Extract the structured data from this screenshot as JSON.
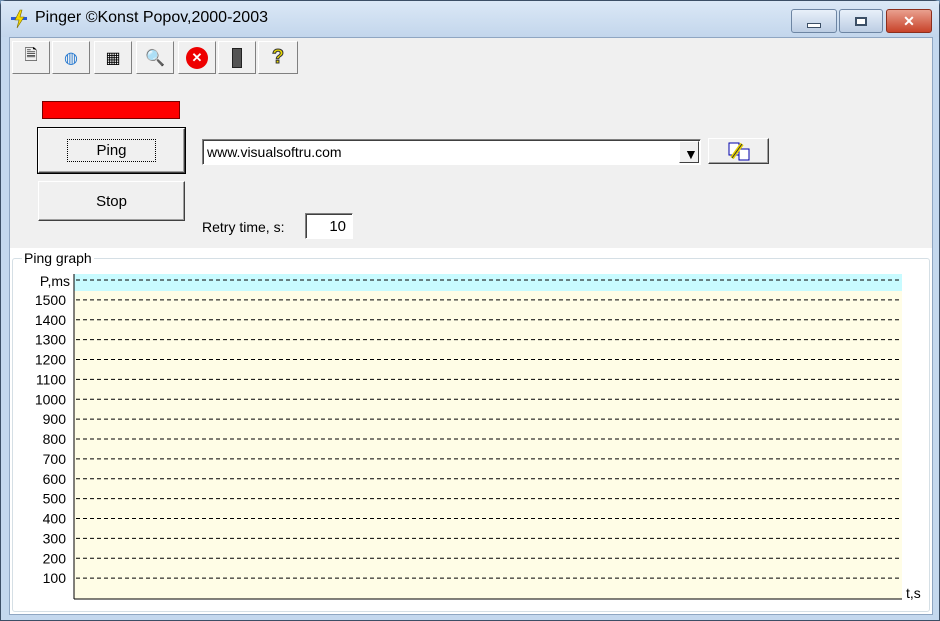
{
  "window": {
    "title": "Pinger ©Konst Popov,2000-2003",
    "controls": [
      "minimize",
      "maximize",
      "close"
    ]
  },
  "toolbar": [
    {
      "icon": "properties-icon",
      "glyph": "🗎"
    },
    {
      "icon": "network-search-icon",
      "glyph": "🌐"
    },
    {
      "icon": "log-table-icon",
      "glyph": "▦"
    },
    {
      "icon": "find-icon",
      "glyph": "🔍"
    },
    {
      "icon": "stop-red-icon",
      "glyph": "✕"
    },
    {
      "icon": "server-icon",
      "glyph": "▮"
    },
    {
      "icon": "help-icon",
      "glyph": "?"
    }
  ],
  "status_indicator": {
    "color": "#ff0000"
  },
  "buttons": {
    "ping": "Ping",
    "stop": "Stop"
  },
  "host": {
    "value": "www.visualsoftru.com"
  },
  "retry": {
    "label": "Retry time, s:",
    "value": "10"
  },
  "graph": {
    "group_label": "Ping graph"
  },
  "chart_data": {
    "type": "line",
    "ylabel": "P,ms",
    "xlabel": "t,s",
    "ylim": [
      0,
      1600
    ],
    "yticks": [
      100,
      200,
      300,
      400,
      500,
      600,
      700,
      800,
      900,
      1000,
      1100,
      1200,
      1300,
      1400,
      1500
    ],
    "grid": true,
    "series": [],
    "colors": {
      "plot_bg": "#fffde6",
      "top_band": "#c8fbff"
    }
  }
}
